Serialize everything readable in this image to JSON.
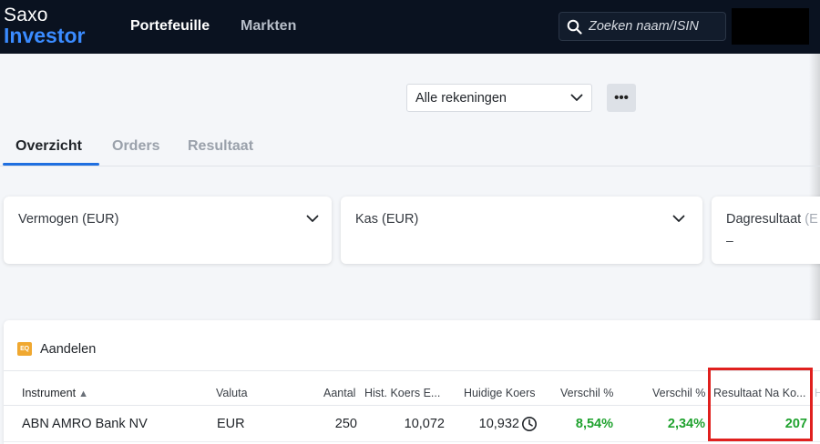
{
  "brand": {
    "line1": "Saxo",
    "line2": "Investor",
    "accent_color": "#3a8bff"
  },
  "nav": {
    "portfolio": "Portefeuille",
    "markets": "Markten"
  },
  "search": {
    "placeholder": "Zoeken naam/ISIN",
    "icon": "search-icon"
  },
  "account_select": {
    "value": "Alle rekeningen",
    "icon": "chevron-down-icon"
  },
  "more_button": {
    "label": "•••"
  },
  "tabs": [
    {
      "label": "Overzicht",
      "active": true
    },
    {
      "label": "Orders",
      "active": false
    },
    {
      "label": "Resultaat",
      "active": false
    }
  ],
  "cards": [
    {
      "title": "Vermogen (EUR)",
      "value": ""
    },
    {
      "title": "Kas (EUR)",
      "value": ""
    },
    {
      "title": "Dagresultaat",
      "title_suffix": " (E",
      "value": "–"
    }
  ],
  "holdings": {
    "badge": "EQ",
    "title": "Aandelen",
    "columns": {
      "instrument": "Instrument",
      "sort_indicator": "▲",
      "valuta": "Valuta",
      "aantal": "Aantal",
      "hist_koers": "Hist. Koers E...",
      "huidige_koers": "Huidige Koers",
      "verschil_pct": "Verschil %",
      "verschil_pct_2": "Verschil %",
      "resultaat": "Resultaat Na Ko...",
      "cut": "H"
    },
    "rows": [
      {
        "instrument": "ABN AMRO Bank NV",
        "valuta": "EUR",
        "aantal": "250",
        "hist_koers": "10,072",
        "huidige_koers": "10,932",
        "verschil_pct": "8,54%",
        "verschil_pct_2": "2,34%",
        "resultaat": "207"
      }
    ],
    "positive_color": "#1fa22e"
  },
  "highlight_color": "#e0201e"
}
